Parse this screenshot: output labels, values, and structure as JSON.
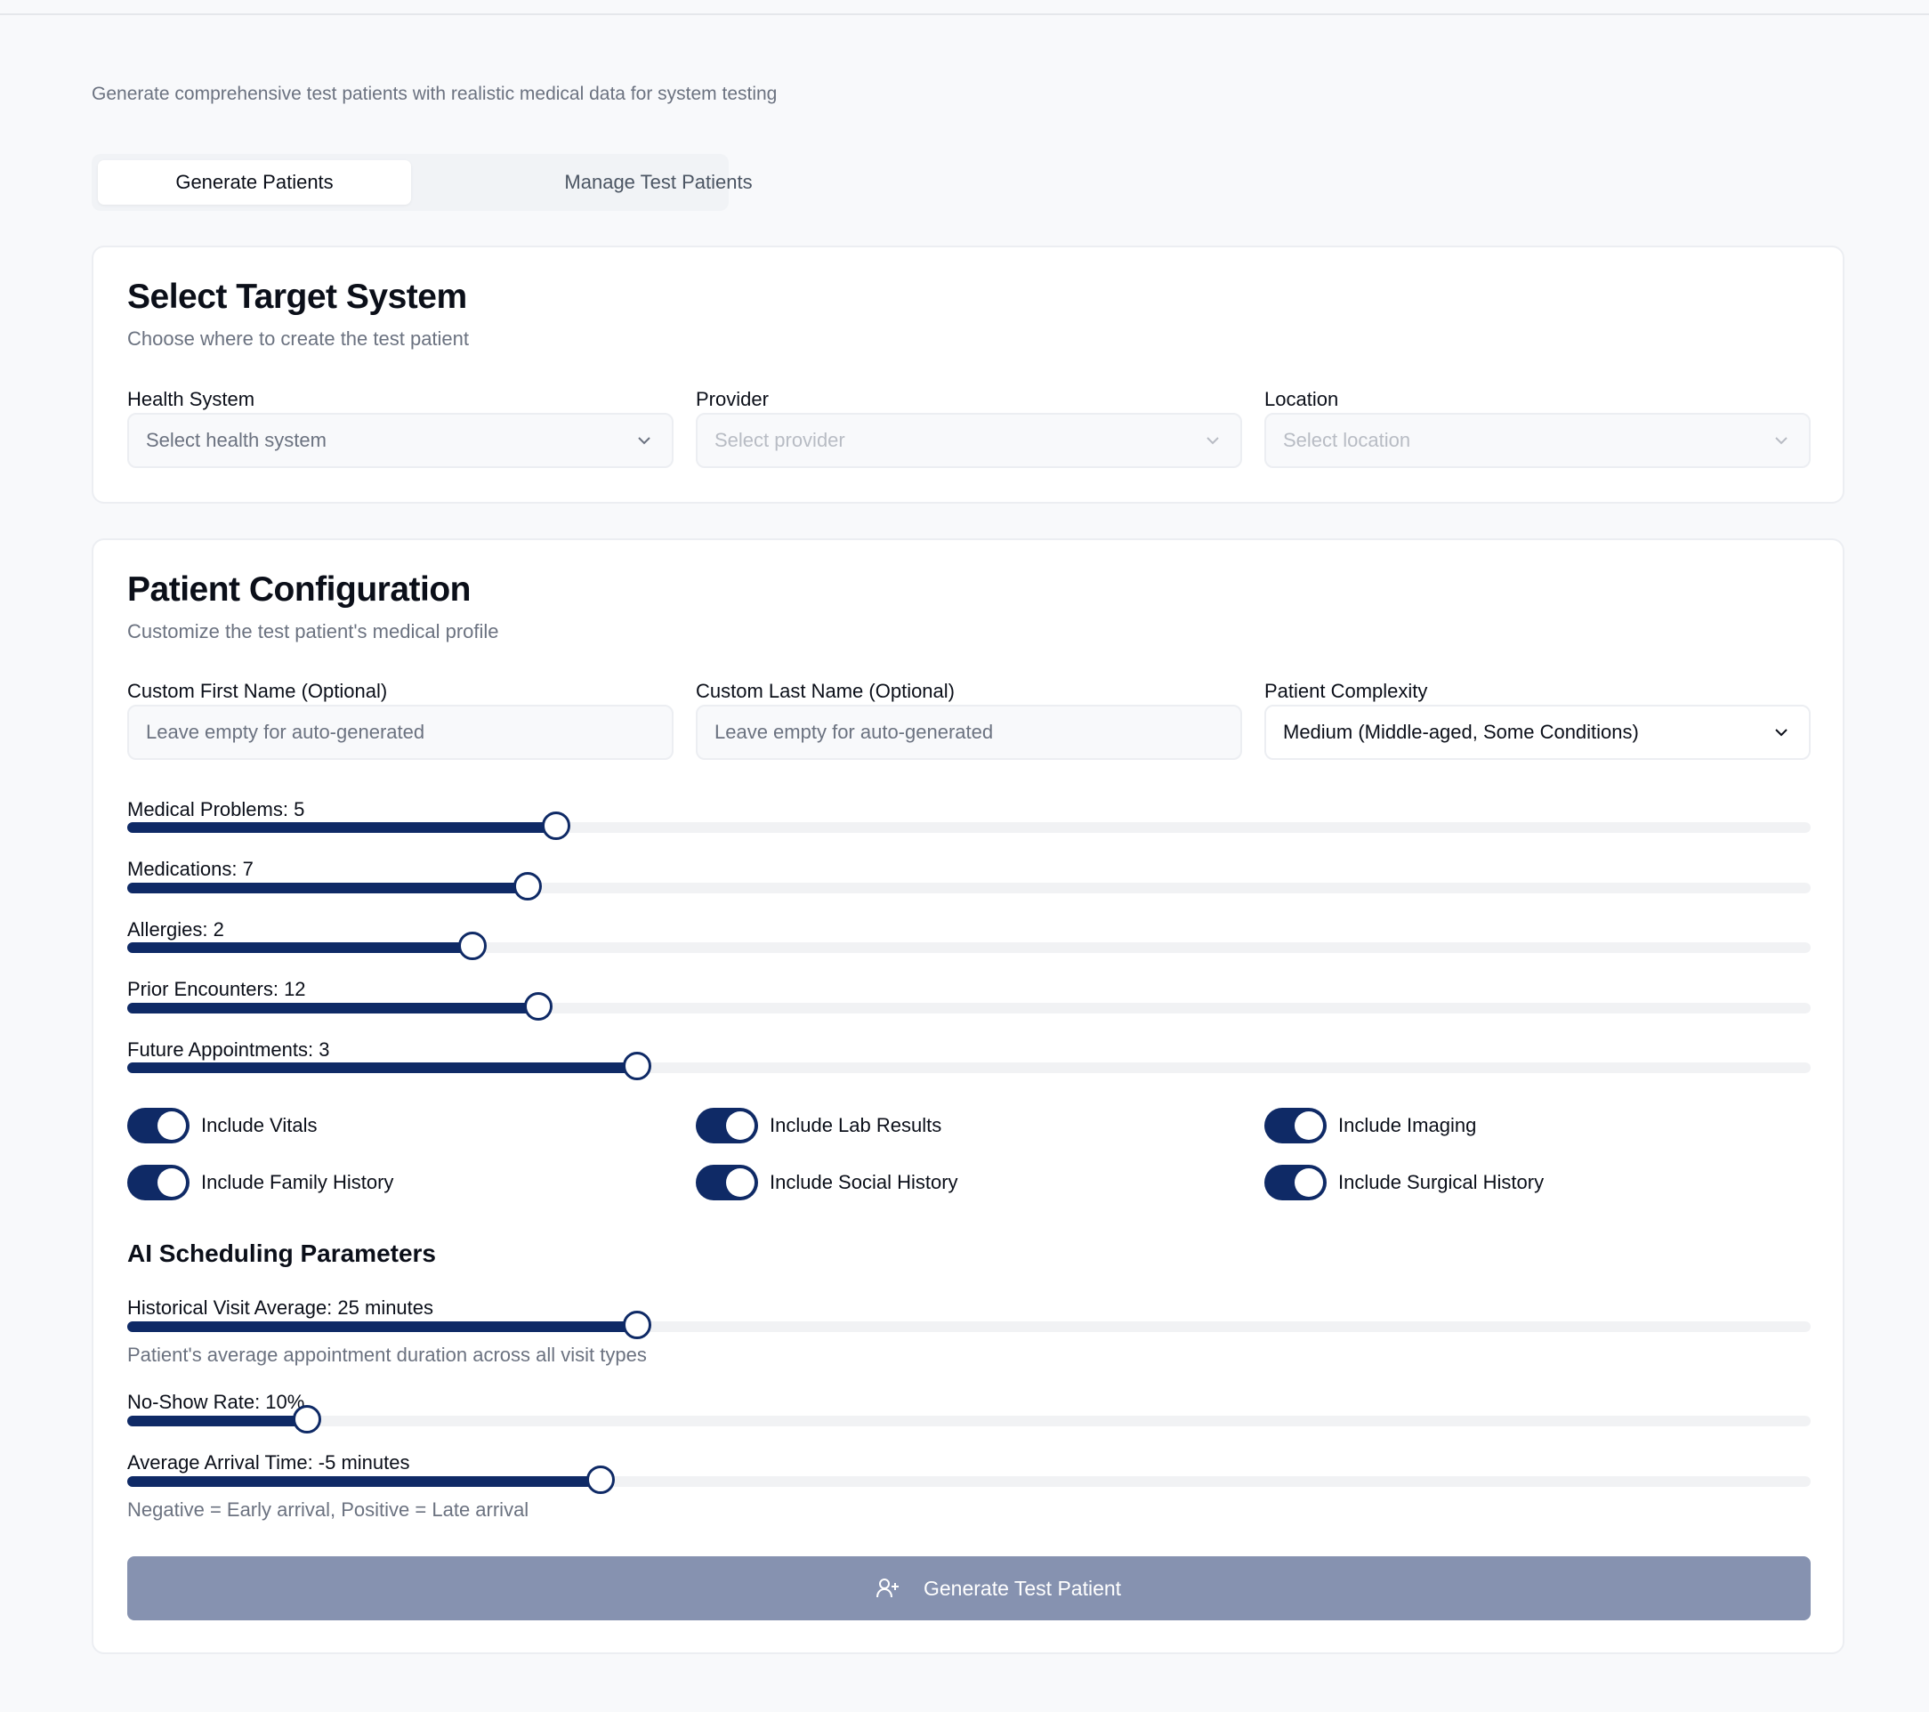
{
  "subtitle": "Generate comprehensive test patients with realistic medical data for system testing",
  "tabs": [
    {
      "label": "Generate Patients",
      "active": true
    },
    {
      "label": "Manage Test Patients",
      "active": false
    }
  ],
  "target": {
    "title": "Select Target System",
    "description": "Choose where to create the test patient",
    "fields": [
      {
        "label": "Health System",
        "placeholder": "Select health system",
        "disabled": false
      },
      {
        "label": "Provider",
        "placeholder": "Select provider",
        "disabled": true
      },
      {
        "label": "Location",
        "placeholder": "Select location",
        "disabled": true
      }
    ]
  },
  "config": {
    "title": "Patient Configuration",
    "description": "Customize the test patient's medical profile",
    "first_name": {
      "label": "Custom First Name (Optional)",
      "placeholder": "Leave empty for auto-generated",
      "value": ""
    },
    "last_name": {
      "label": "Custom Last Name (Optional)",
      "placeholder": "Leave empty for auto-generated",
      "value": ""
    },
    "complexity": {
      "label": "Patient Complexity",
      "value": "Medium (Middle-aged, Some Conditions)"
    },
    "sliders": [
      {
        "label": "Medical Problems: 5",
        "fraction": 0.255
      },
      {
        "label": "Medications: 7",
        "fraction": 0.238
      },
      {
        "label": "Allergies: 2",
        "fraction": 0.205
      },
      {
        "label": "Prior Encounters: 12",
        "fraction": 0.244
      },
      {
        "label": "Future Appointments: 3",
        "fraction": 0.303
      }
    ],
    "toggles": [
      {
        "label": "Include Vitals",
        "on": true
      },
      {
        "label": "Include Lab Results",
        "on": true
      },
      {
        "label": "Include Imaging",
        "on": true
      },
      {
        "label": "Include Family History",
        "on": true
      },
      {
        "label": "Include Social History",
        "on": true
      },
      {
        "label": "Include Surgical History",
        "on": true
      }
    ]
  },
  "ai": {
    "title": "AI Scheduling Parameters",
    "sliders": [
      {
        "label": "Historical Visit Average: 25 minutes",
        "fraction": 0.303,
        "hint": "Patient's average appointment duration across all visit types"
      },
      {
        "label": "No-Show Rate: 10%",
        "fraction": 0.107,
        "hint": ""
      },
      {
        "label": "Average Arrival Time: -5 minutes",
        "fraction": 0.281,
        "hint": "Negative = Early arrival, Positive = Late arrival"
      }
    ]
  },
  "generate_button": {
    "label": "Generate Test Patient",
    "icon": "user-plus-icon"
  },
  "colors": {
    "accent": "#0f2a66",
    "button_disabled": "#8692b0"
  }
}
